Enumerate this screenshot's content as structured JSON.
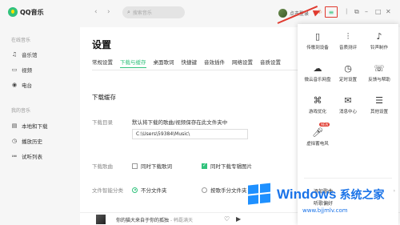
{
  "app": {
    "name": "QQ音乐"
  },
  "sidebar": {
    "section_online": "在线音乐",
    "online_items": [
      {
        "label": "音乐馆",
        "icon": "music-note-icon"
      },
      {
        "label": "视频",
        "icon": "video-icon"
      },
      {
        "label": "电台",
        "icon": "radio-icon"
      }
    ],
    "section_mine": "我的音乐",
    "mine_items": [
      {
        "label": "本地和下载",
        "icon": "local-download-icon"
      },
      {
        "label": "播放历史",
        "icon": "history-icon"
      },
      {
        "label": "试听列表",
        "icon": "playlist-icon"
      }
    ]
  },
  "topbar": {
    "search_placeholder": "搜索音乐",
    "login_label": "点击登录"
  },
  "settings": {
    "title": "设置",
    "tabs": [
      "常规设置",
      "下载与缓存",
      "桌面歌词",
      "快捷键",
      "音效插件",
      "网络设置",
      "音质设置"
    ],
    "active_tab": 1,
    "section_title": "下载缓存",
    "download_dir_label": "下载目录",
    "download_dir_desc": "默认将下载的歌曲/视频保存在此文件夹中",
    "download_dir_path": "C:\\Users\\59384\\Music\\",
    "lyrics_label": "下载歌曲",
    "opt_download_lyrics": "同时下载歌词",
    "opt_download_cover": "同时下载专辑图片",
    "classify_label": "文件智能分类",
    "opt_no_folder": "不分文件夹",
    "opt_by_singer": "按歌手分文件夹"
  },
  "player": {
    "song": "你的猫大来自于你的孤独",
    "artist": "韩磊满天"
  },
  "popup": {
    "items": [
      {
        "label": "传歌到设备",
        "icon": "phone-icon"
      },
      {
        "label": "音质测评",
        "icon": "equalizer-icon"
      },
      {
        "label": "铃声制作",
        "icon": "bell-icon"
      },
      {
        "label": "微云音乐网盘",
        "icon": "cloud-icon"
      },
      {
        "label": "定时设置",
        "icon": "timer-icon"
      },
      {
        "label": "反馈与帮助",
        "icon": "feedback-icon"
      },
      {
        "label": "游戏优化",
        "icon": "gamepad-icon"
      },
      {
        "label": "消息中心",
        "icon": "mail-icon"
      },
      {
        "label": "其他设置",
        "icon": "more-settings-icon"
      },
      {
        "label": "虚拟蓄电风",
        "icon": "microphone-icon"
      }
    ],
    "new_badge": "NEW",
    "add_song": "添加歌曲",
    "listen_prefs": "听歌偏好"
  },
  "watermark": {
    "brand": "Windows",
    "site_name": "系统之家",
    "url": "www.bjjmlv.com"
  },
  "colors": {
    "accent": "#31c27c",
    "annotation": "#e03a2f",
    "watermark": "#1a73e8"
  }
}
